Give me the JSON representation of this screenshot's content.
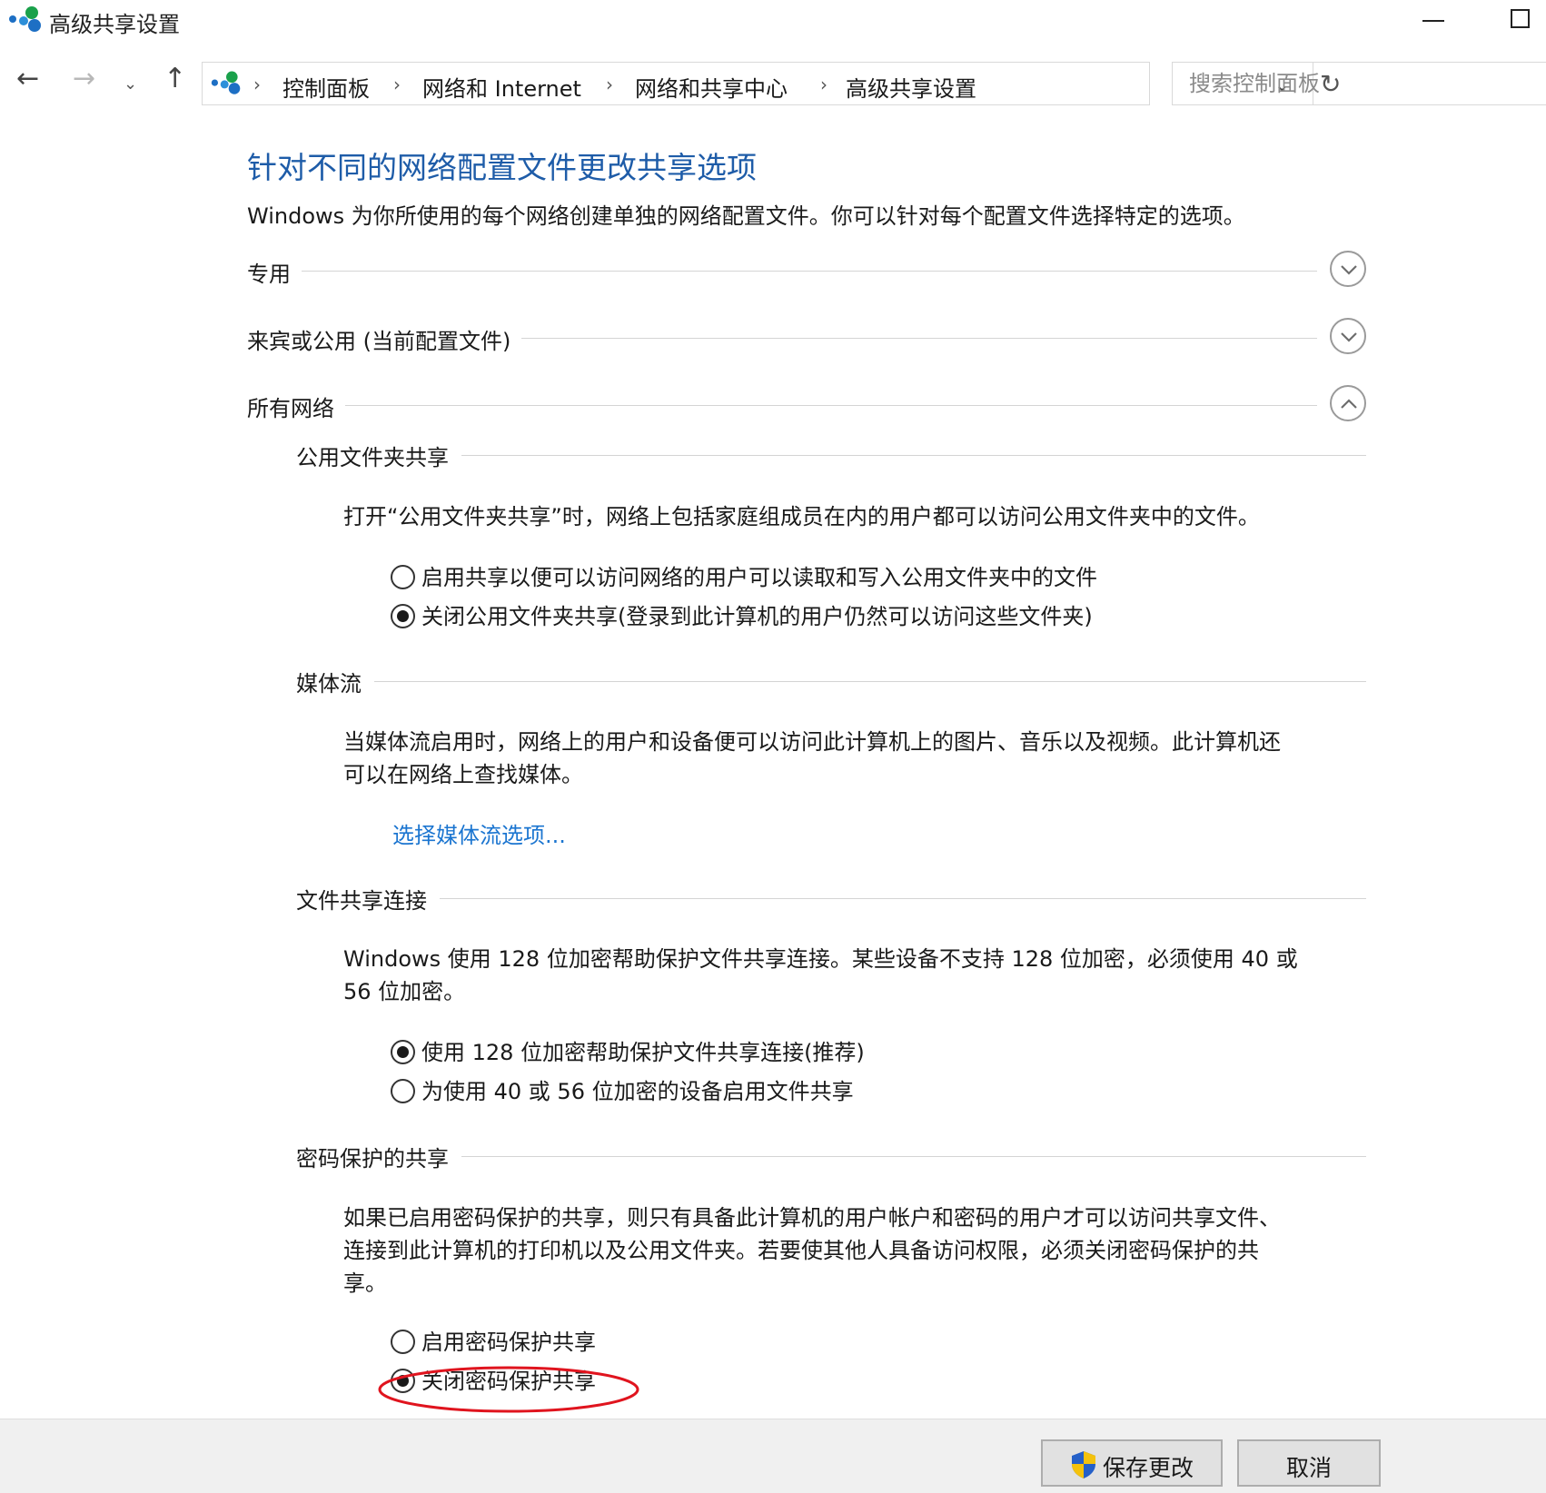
{
  "window": {
    "title": "高级共享设置"
  },
  "nav": {
    "back_icon": "arrow-left-icon",
    "forward_icon": "arrow-right-icon",
    "up_icon": "arrow-up-icon",
    "breadcrumbs": [
      "控制面板",
      "网络和 Internet",
      "网络和共享中心",
      "高级共享设置"
    ],
    "search_placeholder": "搜索控制面板"
  },
  "page": {
    "title": "针对不同的网络配置文件更改共享选项",
    "description": "Windows 为你所使用的每个网络创建单独的网络配置文件。你可以针对每个配置文件选择特定的选项。"
  },
  "profiles": [
    {
      "label": "专用",
      "expanded": false
    },
    {
      "label": "来宾或公用 (当前配置文件)",
      "expanded": false
    },
    {
      "label": "所有网络",
      "expanded": true
    }
  ],
  "all_networks": {
    "public_folder": {
      "heading": "公用文件夹共享",
      "description": "打开“公用文件夹共享”时，网络上包括家庭组成员在内的用户都可以访问公用文件夹中的文件。",
      "options": [
        {
          "label": "启用共享以便可以访问网络的用户可以读取和写入公用文件夹中的文件",
          "checked": false
        },
        {
          "label": "关闭公用文件夹共享(登录到此计算机的用户仍然可以访问这些文件夹)",
          "checked": true
        }
      ]
    },
    "media_streaming": {
      "heading": "媒体流",
      "description_line1": "当媒体流启用时，网络上的用户和设备便可以访问此计算机上的图片、音乐以及视频。此计算机还",
      "description_line2": "可以在网络上查找媒体。",
      "link": "选择媒体流选项..."
    },
    "file_sharing": {
      "heading": "文件共享连接",
      "description_line1": "Windows 使用 128 位加密帮助保护文件共享连接。某些设备不支持 128 位加密，必须使用 40 或",
      "description_line2": "56 位加密。",
      "options": [
        {
          "label": "使用 128 位加密帮助保护文件共享连接(推荐)",
          "checked": true
        },
        {
          "label": "为使用 40 或 56 位加密的设备启用文件共享",
          "checked": false
        }
      ]
    },
    "password_protected": {
      "heading": "密码保护的共享",
      "description_line1": "如果已启用密码保护的共享，则只有具备此计算机的用户帐户和密码的用户才可以访问共享文件、",
      "description_line2": "连接到此计算机的打印机以及公用文件夹。若要使其他人具备访问权限，必须关闭密码保护的共",
      "description_line3": "享。",
      "options": [
        {
          "label": "启用密码保护共享",
          "checked": false
        },
        {
          "label": "关闭密码保护共享",
          "checked": true
        }
      ]
    }
  },
  "annotation": {
    "color": "#e0141e"
  },
  "footer": {
    "save_label": "保存更改",
    "cancel_label": "取消",
    "save_icon": "uac-shield-icon"
  },
  "colors": {
    "title_blue": "#1e5ca8",
    "link_blue": "#1b75d0"
  }
}
